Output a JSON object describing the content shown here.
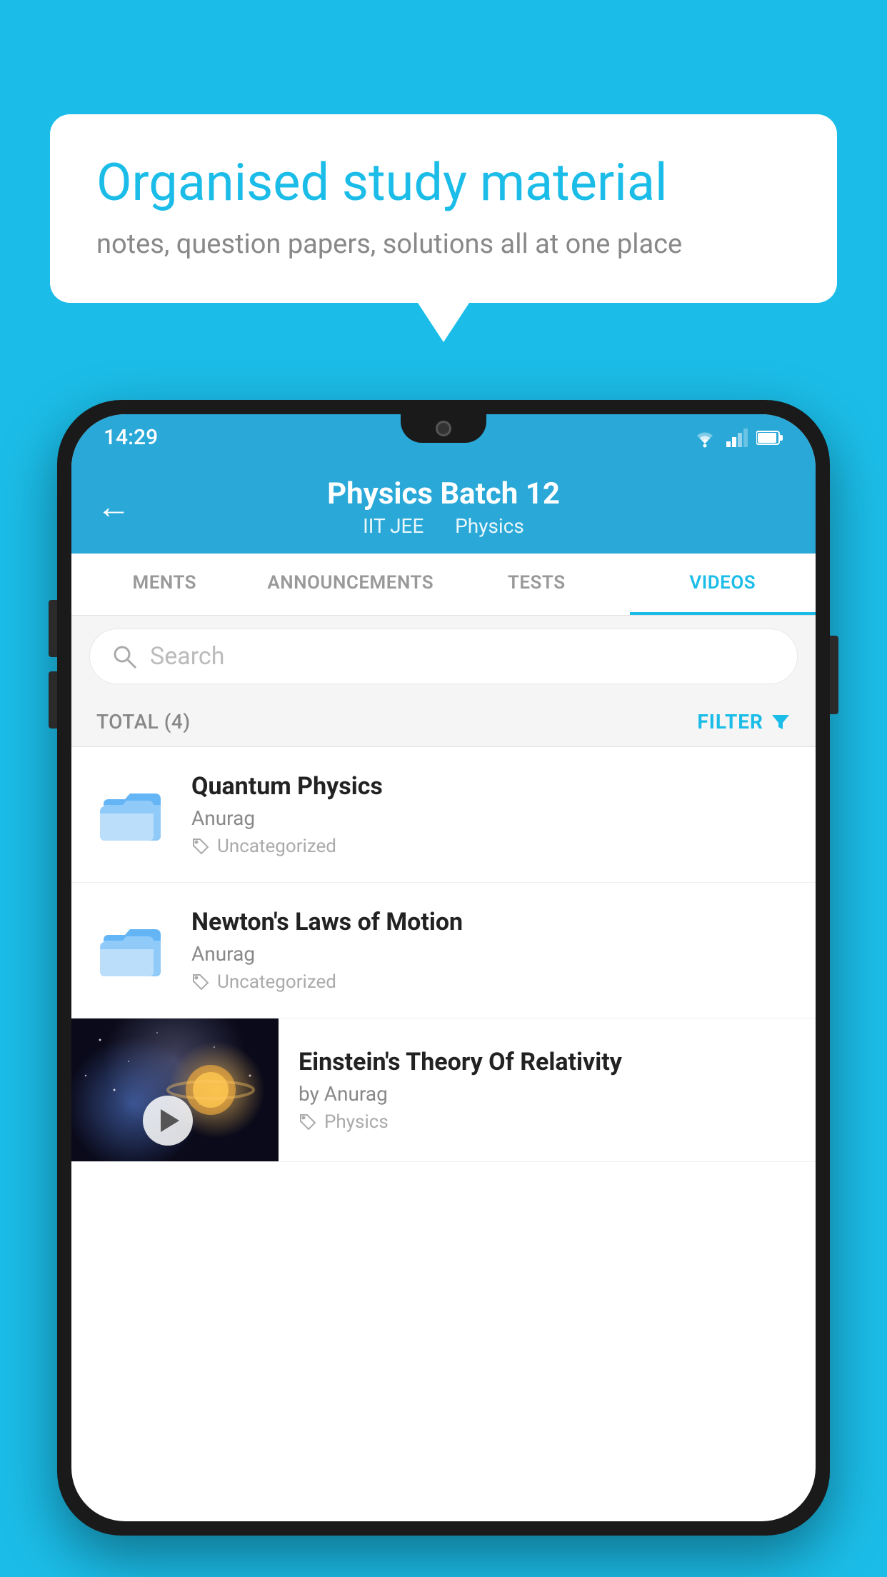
{
  "background_color": "#1bbde8",
  "speech_bubble": {
    "title": "Organised study material",
    "subtitle": "notes, question papers, solutions all at one place"
  },
  "status_bar": {
    "time": "14:29",
    "wifi": "▼",
    "signal": "▲",
    "battery": "▮"
  },
  "app_header": {
    "back_label": "←",
    "title": "Physics Batch 12",
    "subtitle_left": "IIT JEE",
    "subtitle_right": "Physics"
  },
  "tabs": [
    {
      "label": "MENTS",
      "active": false
    },
    {
      "label": "ANNOUNCEMENTS",
      "active": false
    },
    {
      "label": "TESTS",
      "active": false
    },
    {
      "label": "VIDEOS",
      "active": true
    }
  ],
  "search": {
    "placeholder": "Search"
  },
  "filter_bar": {
    "total_label": "TOTAL (4)",
    "filter_label": "FILTER"
  },
  "videos": [
    {
      "id": 1,
      "title": "Quantum Physics",
      "author": "Anurag",
      "tag": "Uncategorized",
      "has_thumb": false
    },
    {
      "id": 2,
      "title": "Newton's Laws of Motion",
      "author": "Anurag",
      "tag": "Uncategorized",
      "has_thumb": false
    },
    {
      "id": 3,
      "title": "Einstein's Theory Of Relativity",
      "author": "by Anurag",
      "tag": "Physics",
      "has_thumb": true
    }
  ]
}
